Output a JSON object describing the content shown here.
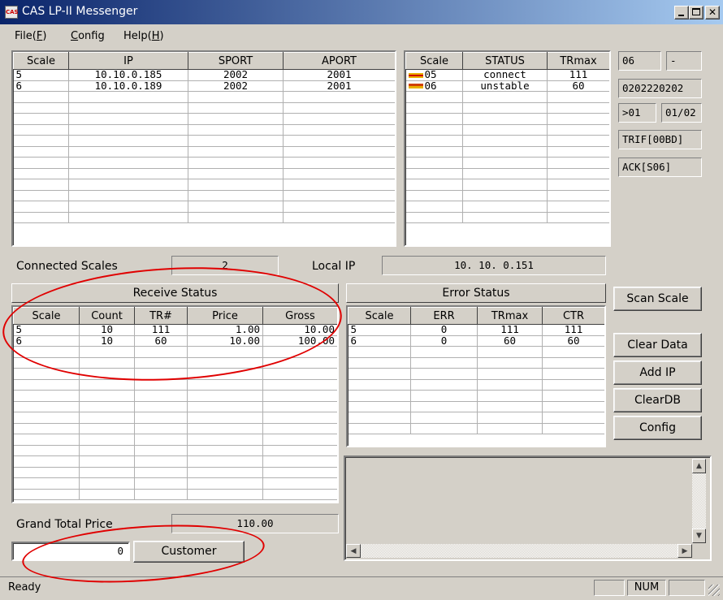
{
  "window": {
    "title": "CAS LP-II Messenger",
    "icon_text": "CAS"
  },
  "menu": [
    {
      "label_pre": "File(",
      "accel": "F",
      "label_post": ")"
    },
    {
      "label_pre": "",
      "accel": "C",
      "label_post": "onfig"
    },
    {
      "label_pre": "Help(",
      "accel": "H",
      "label_post": ")"
    }
  ],
  "scale_table": {
    "headers": [
      "Scale",
      "IP",
      "SPORT",
      "APORT"
    ],
    "rows": [
      [
        "5",
        "10.10.0.185",
        "2002",
        "2001"
      ],
      [
        "6",
        "10.10.0.189",
        "2002",
        "2001"
      ]
    ]
  },
  "status_table": {
    "headers": [
      "Scale",
      "STATUS",
      "TRmax"
    ],
    "rows": [
      {
        "flag": "connect",
        "scale": "05",
        "status": "connect",
        "trmax": "111"
      },
      {
        "flag": "unstable",
        "scale": "06",
        "status": "unstable",
        "trmax": "60"
      }
    ]
  },
  "info": {
    "scale_no": "06",
    "dash": "-",
    "code": "0202220202",
    "index": ">01",
    "page": "01/02",
    "trif": "TRIF[00BD]",
    "ack": "ACK[S06]"
  },
  "connected_scales": {
    "label": "Connected Scales",
    "value": "2"
  },
  "local_ip": {
    "label": "Local IP",
    "value": "10. 10.  0.151"
  },
  "receive_status": {
    "title": "Receive Status",
    "headers": [
      "Scale",
      "Count",
      "TR#",
      "Price",
      "Gross"
    ],
    "rows": [
      [
        "5",
        "10",
        "111",
        "1.00",
        "10.00"
      ],
      [
        "6",
        "10",
        "60",
        "10.00",
        "100.00"
      ]
    ]
  },
  "error_status": {
    "title": "Error Status",
    "headers": [
      "Scale",
      "ERR",
      "TRmax",
      "CTR"
    ],
    "rows": [
      [
        "5",
        "0",
        "111",
        "111"
      ],
      [
        "6",
        "0",
        "60",
        "60"
      ]
    ]
  },
  "buttons": {
    "scan_scale": "Scan Scale",
    "clear_data": "Clear Data",
    "add_ip": "Add IP",
    "clear_db": "ClearDB",
    "config": "Config",
    "customer": "Customer"
  },
  "grand_total": {
    "label": "Grand Total Price",
    "value": "110.00"
  },
  "customer_input": {
    "value": "0"
  },
  "statusbar": {
    "text": "Ready",
    "num": "NUM"
  },
  "colors": {
    "title_start": "#0a246a",
    "title_end": "#a6caf0",
    "annotation": "#e00000",
    "flag_connect": "#e8b000",
    "flag_unstable": "#d04000"
  }
}
